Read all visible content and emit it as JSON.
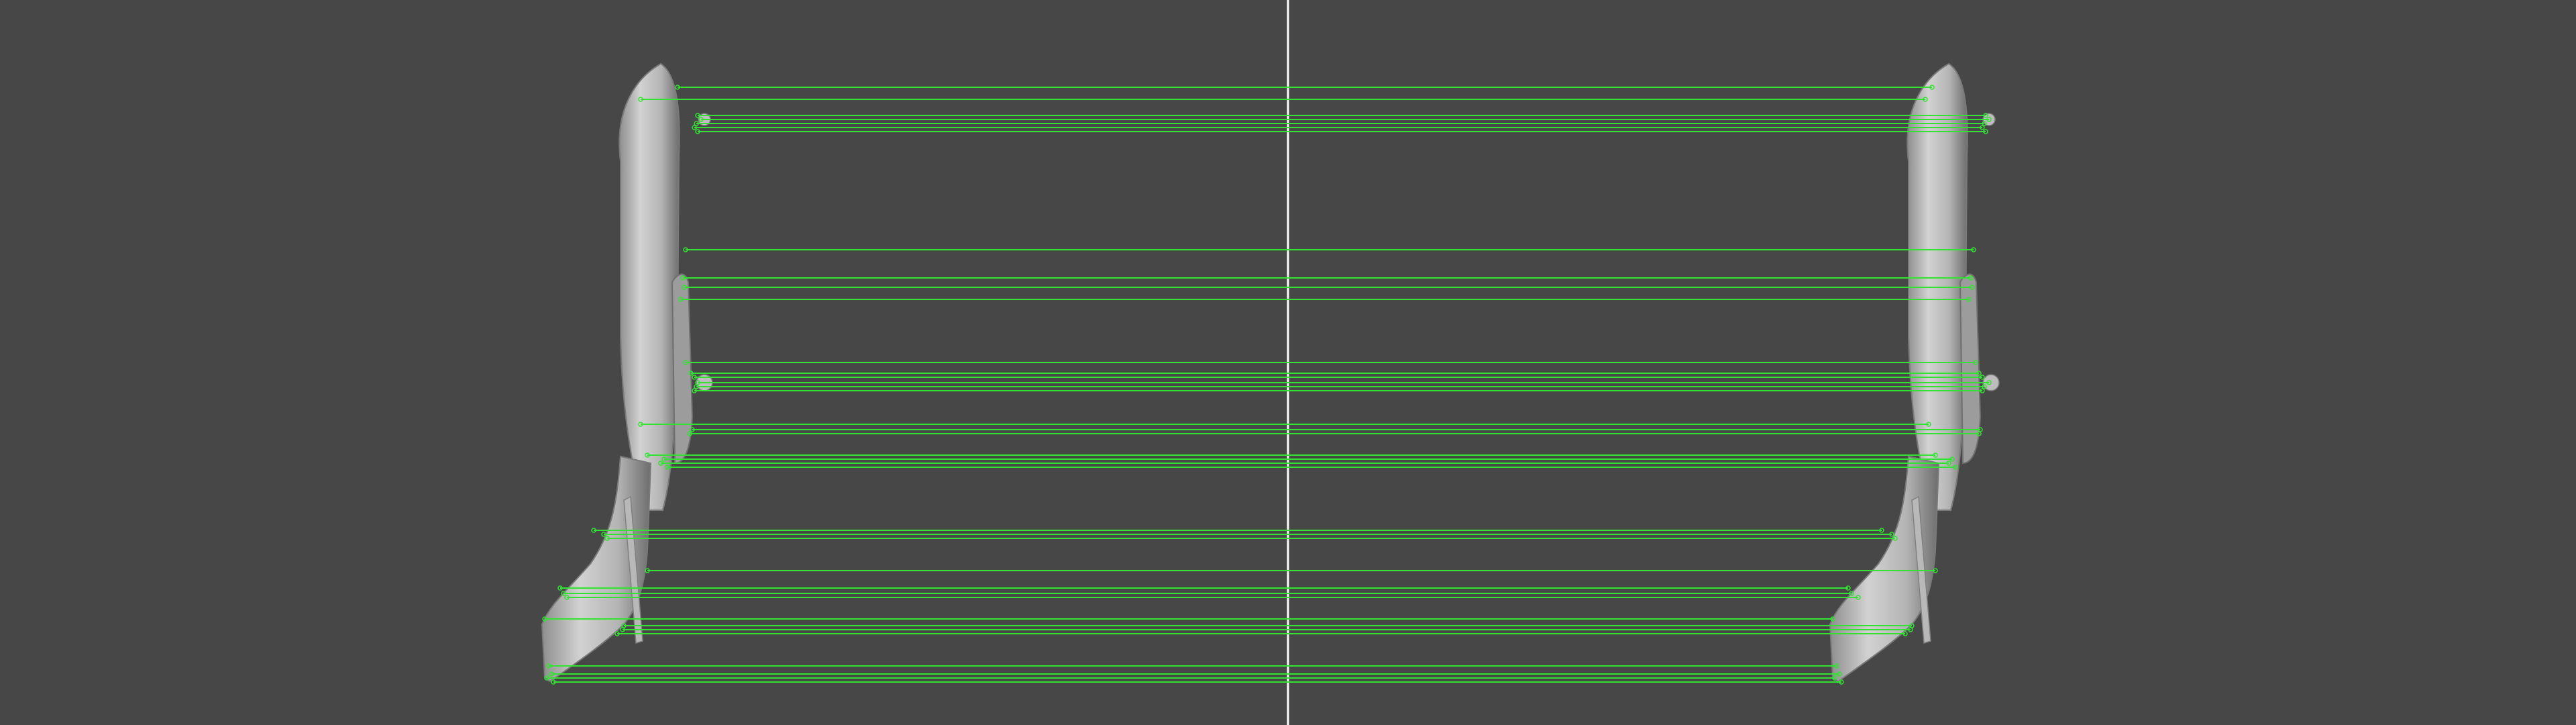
{
  "colors": {
    "background": "#474747",
    "divider": "#ffffff",
    "match_line": "#34e234",
    "model_light": "#c8c8c8",
    "model_mid": "#a9a9a9",
    "model_dark": "#7e7e7e"
  },
  "views": {
    "left_label": "",
    "right_label": ""
  }
}
